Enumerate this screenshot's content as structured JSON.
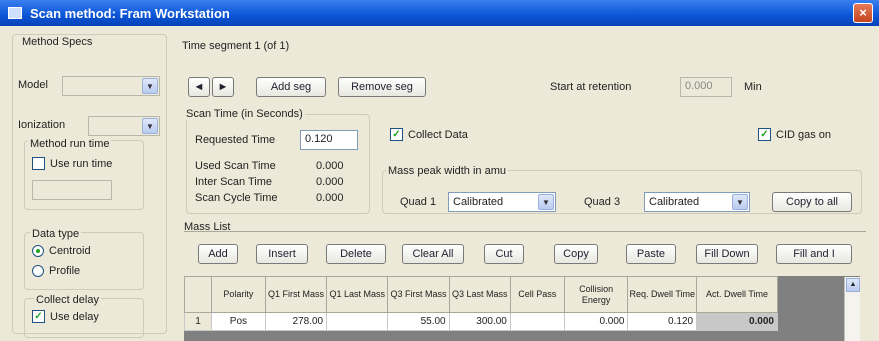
{
  "window": {
    "title": "Scan method: Fram Workstation",
    "close_glyph": "×"
  },
  "left": {
    "method_specs_label": "Method Specs",
    "model_label": "Model",
    "model_value": "",
    "ionization_label": "Ionization",
    "ionization_value": "",
    "method_run_time_label": "Method run time",
    "use_run_time_label": "Use run time",
    "run_time_value": "",
    "data_type_label": "Data type",
    "data_type_options": [
      "Centroid",
      "Profile"
    ],
    "data_type_selected": "Centroid",
    "collect_delay_label": "Collect delay",
    "use_delay_label": "Use delay"
  },
  "segment": {
    "label": "Time segment 1 (of 1)",
    "nav_prev": "◄",
    "nav_next": "►",
    "add_seg": "Add seg",
    "remove_seg": "Remove seg",
    "start_at_retention_label": "Start at retention",
    "start_at_value": "0.000",
    "start_at_unit": "Min"
  },
  "scan_time": {
    "group_label": "Scan Time (in Seconds)",
    "requested_label": "Requested Time",
    "requested_value": "0.120",
    "used_label": "Used Scan Time",
    "used_value": "0.000",
    "inter_label": "Inter Scan Time",
    "inter_value": "0.000",
    "cycle_label": "Scan Cycle Time",
    "cycle_value": "0.000"
  },
  "collect_data_label": "Collect Data",
  "cid_gas_label": "CID gas on",
  "peak_width": {
    "label": "Mass peak width in amu",
    "quad1_label": "Quad 1",
    "quad1_value": "Calibrated",
    "quad3_label": "Quad 3",
    "quad3_value": "Calibrated",
    "copy_to_all": "Copy to all"
  },
  "mass_list": {
    "label": "Mass List",
    "buttons": [
      "Add",
      "Insert",
      "Delete",
      "Clear All",
      "Cut",
      "Copy",
      "Paste",
      "Fill Down",
      "Fill and I"
    ],
    "columns": [
      "Polarity",
      "Q1 First Mass",
      "Q1 Last Mass",
      "Q3 First Mass",
      "Q3 Last Mass",
      "Cell Pass",
      "Collision Energy",
      "Req. Dwell Time",
      "Act. Dwell Time"
    ],
    "rows": [
      {
        "num": "1",
        "cells": [
          "Pos",
          "278.00",
          "",
          "55.00",
          "300.00",
          "",
          "0.000",
          "0.120",
          "0.000"
        ]
      }
    ]
  }
}
